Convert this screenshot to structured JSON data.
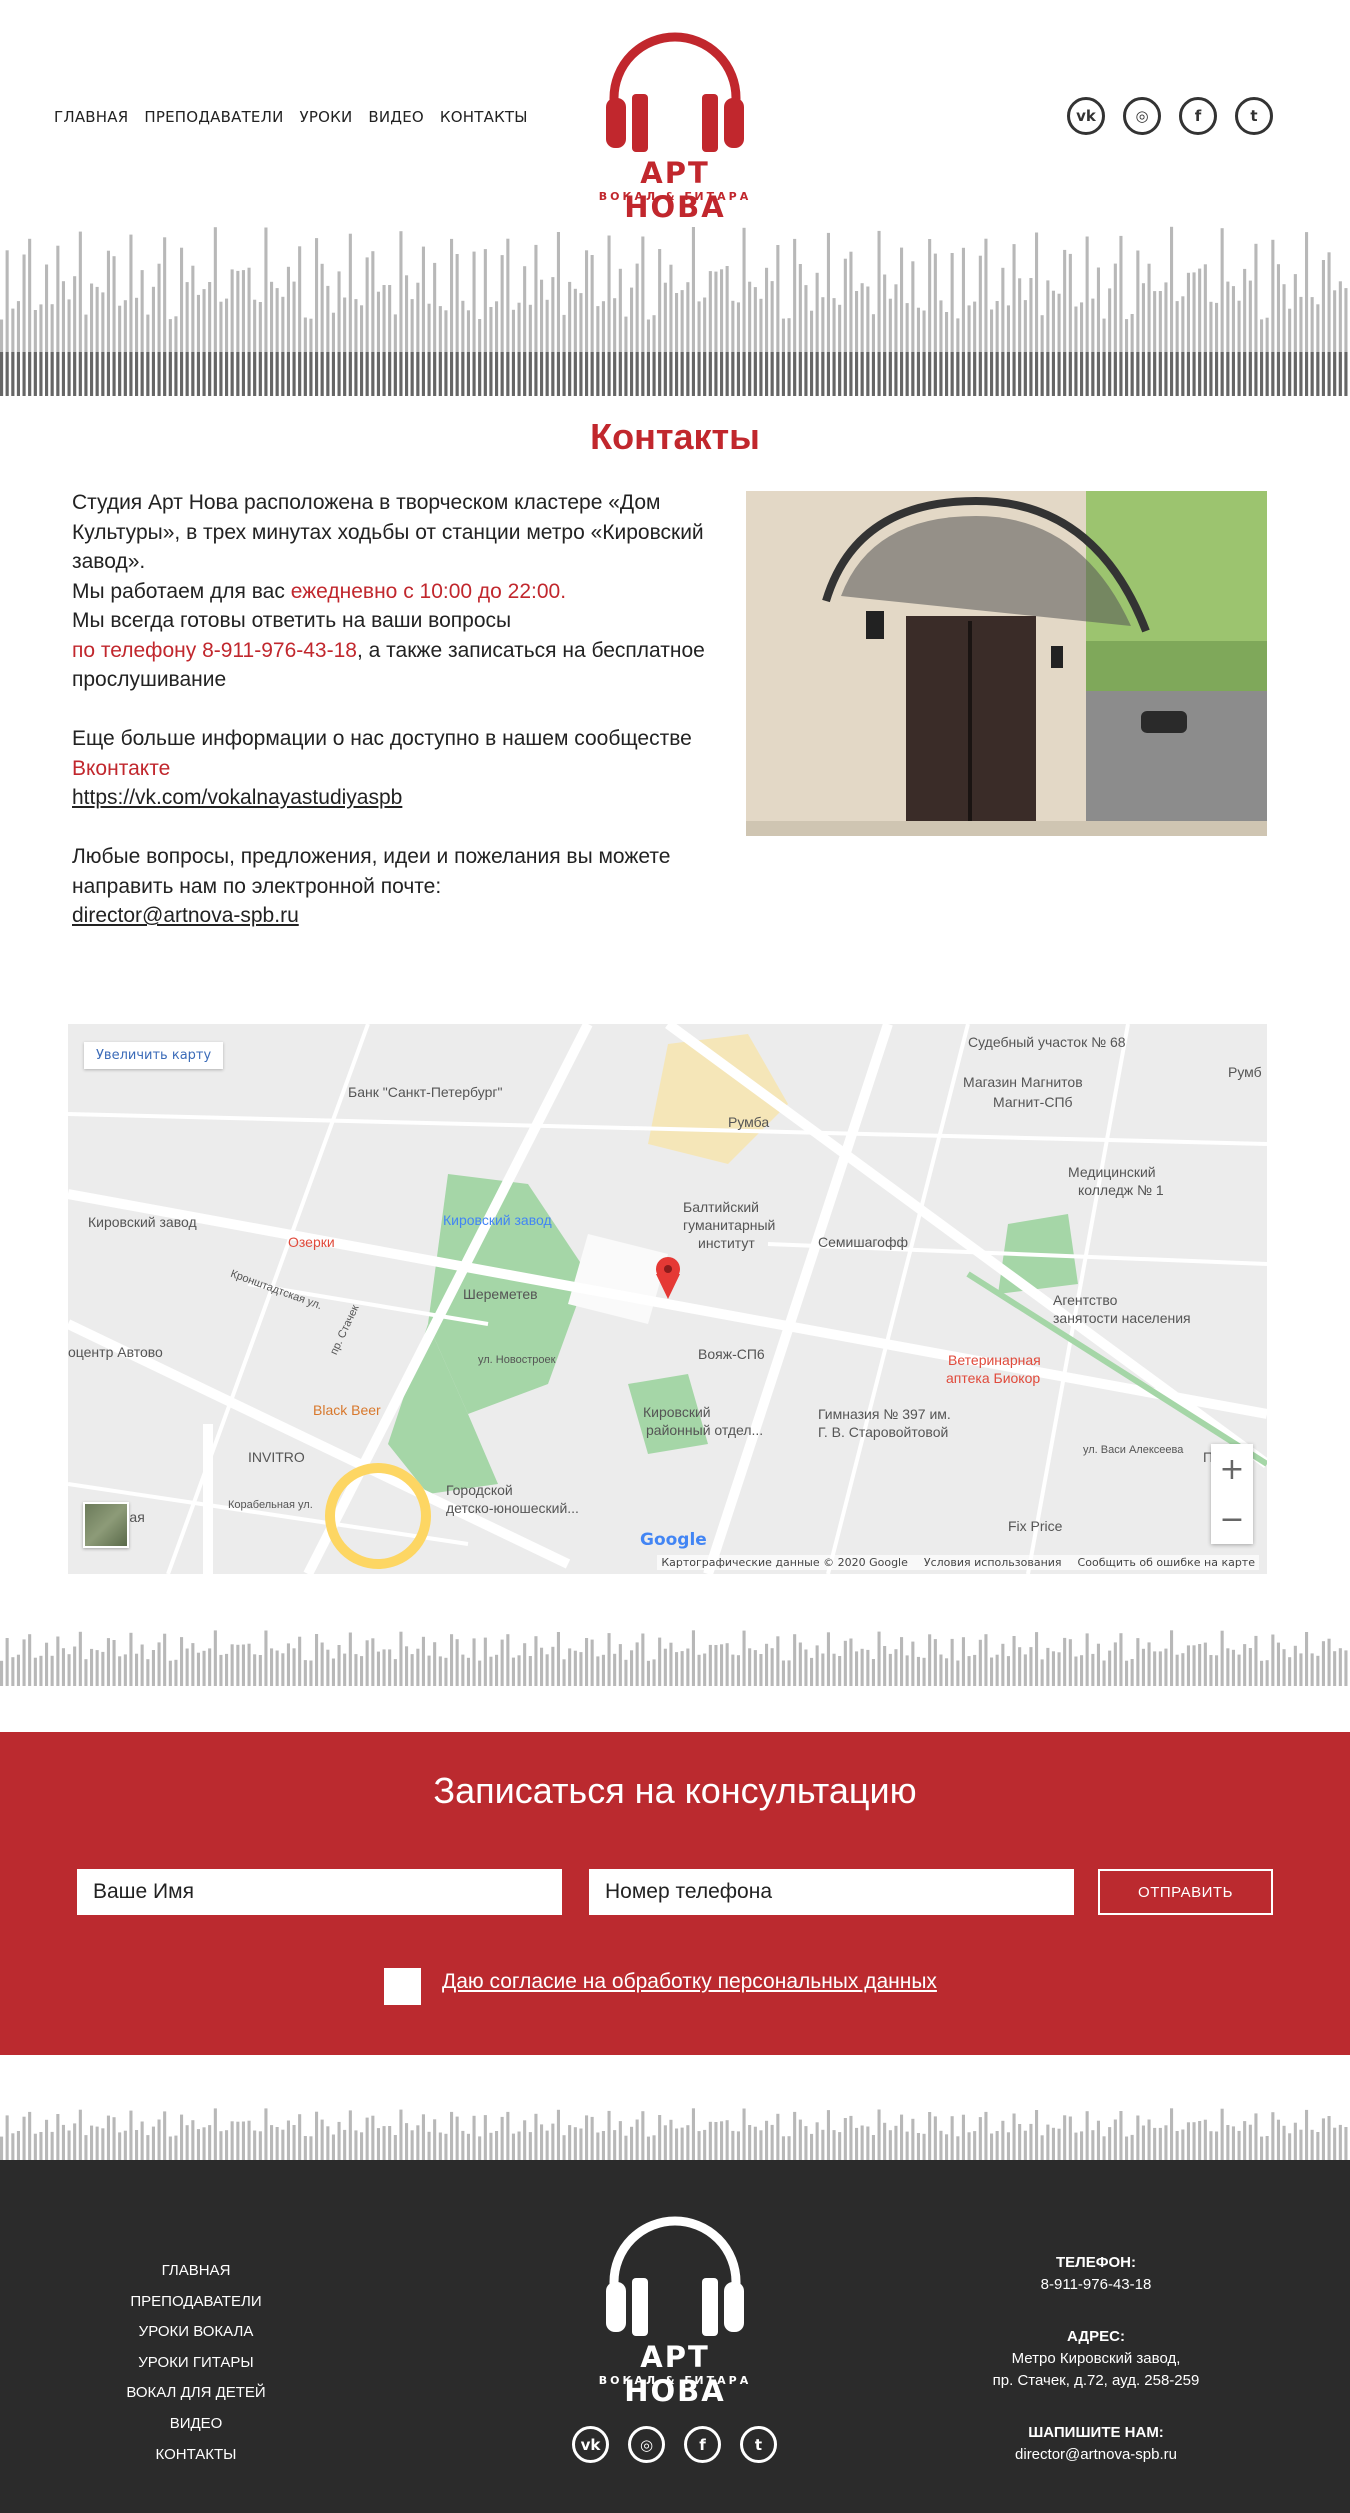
{
  "header": {
    "nav": [
      "ГЛАВНАЯ",
      "ПРЕПОДАВАТЕЛИ",
      "УРОКИ",
      "ВИДЕО",
      "КОНТАКТЫ"
    ],
    "brand": "АРТ НОВА",
    "brand_sub": "ВОКАЛ & ГИТАРА",
    "social": [
      {
        "name": "vk-icon",
        "glyph": "vk"
      },
      {
        "name": "instagram-icon",
        "glyph": "◎"
      },
      {
        "name": "facebook-icon",
        "glyph": "f"
      },
      {
        "name": "twitter-icon",
        "glyph": "t"
      }
    ]
  },
  "contacts": {
    "title": "Контакты",
    "p1_a": "Студия Арт Нова расположена в творческом кластере «Дом Культуры», в трех минутах ходьбы от станции метро «Кировский завод».",
    "p1_b": "Мы работаем для вас ",
    "p1_hours": "ежедневно с 10:00 до 22:00.",
    "p1_c": "Мы всегда готовы ответить на ваши вопросы",
    "p1_phone": "по телефону 8-911-976-43-18",
    "p1_d": ", а также записаться на бесплатное прослушивание",
    "p2_a": "Еще больше информации о нас доступно в нашем сообществе ",
    "p2_vk": "Вконтакте",
    "p2_link": "https://vk.com/vokalnayastudiyaspb",
    "p3_a": "Любые вопросы, предложения, идеи и пожелания вы можете направить нам по электронной почте:",
    "p3_email": "director@artnova-spb.ru"
  },
  "map": {
    "enlarge": "Увеличить карту",
    "labels": [
      {
        "t": "Судебный участок № 68",
        "c": ""
      },
      {
        "t": "Банк \"Санкт-Петербург\"",
        "c": ""
      },
      {
        "t": "Румба",
        "c": ""
      },
      {
        "t": "Магазин Магнитов",
        "c": ""
      },
      {
        "t": "Магнит-СПб",
        "c": ""
      },
      {
        "t": "Румб",
        "c": ""
      },
      {
        "t": "Кировский завод",
        "c": ""
      },
      {
        "t": "Озерки",
        "c": "red"
      },
      {
        "t": "Балтийский",
        "c": ""
      },
      {
        "t": "гуманитарный",
        "c": ""
      },
      {
        "t": "институт",
        "c": ""
      },
      {
        "t": "Медицинский",
        "c": ""
      },
      {
        "t": "колледж № 1",
        "c": ""
      },
      {
        "t": "Кировский завод",
        "c": "blue"
      },
      {
        "t": "Семишагофф",
        "c": ""
      },
      {
        "t": "Шереметев",
        "c": ""
      },
      {
        "t": "Агентство",
        "c": ""
      },
      {
        "t": "занятости населения",
        "c": ""
      },
      {
        "t": "оцентр Автово",
        "c": ""
      },
      {
        "t": "Вояж-СП6",
        "c": ""
      },
      {
        "t": "Ветеринарная",
        "c": "red"
      },
      {
        "t": "аптека Биокор",
        "c": "red"
      },
      {
        "t": "Black Beer",
        "c": "orange"
      },
      {
        "t": "Кировский",
        "c": ""
      },
      {
        "t": "районный отдел...",
        "c": ""
      },
      {
        "t": "Гимназия № 397 им.",
        "c": ""
      },
      {
        "t": "Г. В. Старовойтовой",
        "c": ""
      },
      {
        "t": "INVITRO",
        "c": ""
      },
      {
        "t": "Пловд",
        "c": ""
      },
      {
        "t": "Городской",
        "c": ""
      },
      {
        "t": "детско-юношеский...",
        "c": ""
      },
      {
        "t": "Fix Price",
        "c": ""
      },
      {
        "t": "кая",
        "c": ""
      },
      {
        "t": "ул. Васи Алексеева",
        "c": ""
      },
      {
        "t": "пр. Стачек",
        "c": ""
      },
      {
        "t": "Кронштадтская ул.",
        "c": ""
      },
      {
        "t": "Корабельная ул.",
        "c": ""
      },
      {
        "t": "ул. Новостроек",
        "c": ""
      }
    ],
    "google": "Google",
    "attribution": [
      "Картографические данные © 2020 Google",
      "Условия использования",
      "Сообщить об ошибке на карте"
    ],
    "zoom_in": "+",
    "zoom_out": "−"
  },
  "signup": {
    "title": "Записаться на консультацию",
    "name_placeholder": "Ваше Имя",
    "phone_placeholder": "Номер телефона",
    "submit": "ОТПРАВИТЬ",
    "consent": "Даю согласие на обработку персональных данных"
  },
  "footer": {
    "nav": [
      "ГЛАВНАЯ",
      "ПРЕПОДАВАТЕЛИ",
      "УРОКИ ВОКАЛА",
      "УРОКИ ГИТАРЫ",
      "ВОКАЛ ДЛЯ ДЕТЕЙ",
      "ВИДЕО",
      "КОНТАКТЫ"
    ],
    "brand": "АРТ НОВА",
    "brand_sub": "ВОКАЛ & ГИТАРА",
    "phone_label": "ТЕЛЕФОН:",
    "phone": "8-911-976-43-18",
    "address_label": "АДРЕС:",
    "address_1": "Метро Кировский завод,",
    "address_2": "пр. Стачек, д.72, ауд. 258-259",
    "email_label": "ШАПИШИТЕ НАМ:",
    "email": "director@artnova-spb.ru"
  },
  "colors": {
    "accent": "#c1272d",
    "signup_bg": "#bb2a2f",
    "footer_bg": "#2b2b2b"
  }
}
